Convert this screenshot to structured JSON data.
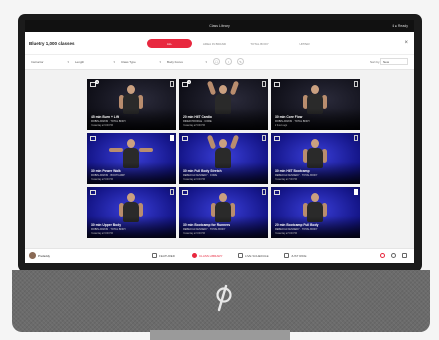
{
  "statusbar": {
    "center_text": "Class Library",
    "right_text": "ℹ ● Ready"
  },
  "header": {
    "title": "Bluetry 1,000 classes",
    "tabs": [
      {
        "label": "ALL",
        "active": true
      },
      {
        "label": "AREA IN BRAND",
        "active": false
      },
      {
        "label": "TOTAL BODY",
        "active": false
      },
      {
        "label": "UPPER",
        "active": false
      }
    ]
  },
  "filters": {
    "items": [
      "Instructor",
      "Length",
      "Class Type",
      "Body Focus"
    ],
    "sort_label": "Sort by",
    "sort_value": "New"
  },
  "classes": [
    {
      "title": "45 min Burn + Lift",
      "meta": "ROBIN ARZON · TOTAL BODY",
      "date": "Yesterday at 6:00 PM",
      "badge": "1",
      "bg": "dark",
      "pose": "normal",
      "bookmark": "outline"
    },
    {
      "title": "20 min HIIT Cardio",
      "meta": "RIDER PROFILE · CORE",
      "date": "Yesterday at 5:00 PM",
      "badge": "1",
      "bg": "dark",
      "pose": "arms-up",
      "bookmark": "outline"
    },
    {
      "title": "30 min Core Flow",
      "meta": "ROBIN ARZON · TOTAL BODY",
      "date": "2 hours ago",
      "badge": "",
      "bg": "dark",
      "pose": "normal",
      "bookmark": "outline"
    },
    {
      "title": "30 min Power Walk",
      "meta": "ROBIN ARZON · BOOTCAMP",
      "date": "Yesterday at 5:00 PM",
      "badge": "",
      "bg": "blue",
      "pose": "arms-wide",
      "bookmark": "filled"
    },
    {
      "title": "30 min Full Body Stretch",
      "meta": "REBECCA KENNEDY · CORE",
      "date": "Yesterday at 6:00 PM",
      "badge": "",
      "bg": "blue",
      "pose": "arms-up",
      "bookmark": "outline"
    },
    {
      "title": "30 min HIIT Bootcamp",
      "meta": "REBECCA KENNEDY · TOTAL BODY",
      "date": "Yesterday at 7:00 PM",
      "badge": "",
      "bg": "blue",
      "pose": "normal",
      "bookmark": "outline"
    },
    {
      "title": "30 min Upper Body",
      "meta": "ROBIN ARZON · TOTAL BODY",
      "date": "Yesterday at 6:00 PM",
      "badge": "",
      "bg": "blue",
      "pose": "normal",
      "bookmark": "outline"
    },
    {
      "title": "30 min Bootcamp for Runners",
      "meta": "REBECCA KENNEDY · TOTAL BODY",
      "date": "Yesterday at 6:00 PM",
      "badge": "",
      "bg": "blue",
      "pose": "normal",
      "bookmark": "outline"
    },
    {
      "title": "20 min Bootcamp Full Body",
      "meta": "REBECCA KENNEDY · TOTAL BODY",
      "date": "Yesterday at 5:00 PM",
      "badge": "",
      "bg": "blue",
      "pose": "normal",
      "bookmark": "filled"
    }
  ],
  "bottomnav": {
    "username": "Prefaddy",
    "items": [
      {
        "label": "FEATURED",
        "active": false
      },
      {
        "label": "CLASS LIBRARY",
        "active": true
      },
      {
        "label": "LIVE SCHEDULE",
        "active": false
      },
      {
        "label": "JUST RIDE",
        "active": false
      }
    ]
  },
  "colors": {
    "accent": "#e8283f",
    "bezel": "#1b1b1b",
    "speaker": "#6b6b6b"
  }
}
